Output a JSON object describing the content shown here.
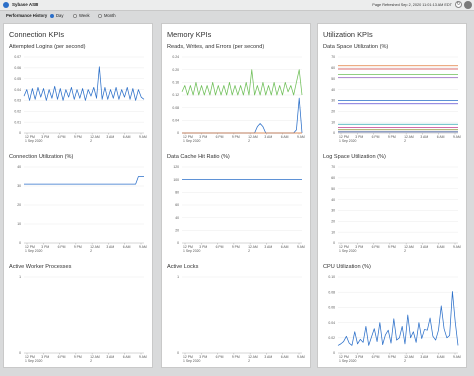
{
  "topbar": {
    "db_name": "Sybase ASE",
    "caret": "▾",
    "refreshed": "Page Refreshed Sep 2, 2020 11:01:13 AM EDT",
    "refresh_icon": "↻"
  },
  "history": {
    "label": "Performance History",
    "options": [
      "Day",
      "Week",
      "Month"
    ],
    "selected": "Day"
  },
  "columns": [
    {
      "title": "Connection KPIs",
      "charts": [
        {
          "title": "Attempted Logins (per second)"
        },
        {
          "title": "Connection Utilization (%)"
        },
        {
          "title": "Active Worker Processes"
        }
      ]
    },
    {
      "title": "Memory KPIs",
      "charts": [
        {
          "title": "Reads, Writes, and Errors (per second)"
        },
        {
          "title": "Data Cache Hit Ratio (%)"
        },
        {
          "title": "Active Locks"
        }
      ]
    },
    {
      "title": "Utilization KPIs",
      "charts": [
        {
          "title": "Data Space Utilization (%)"
        },
        {
          "title": "Log Space Utilization (%)"
        },
        {
          "title": "CPU Utilization (%)"
        }
      ]
    }
  ],
  "x_ticks": [
    "12 PM\n1 Sep 2020",
    "3 PM",
    "6 PM",
    "9 PM",
    "12 AM\n2",
    "3 AM",
    "6 AM",
    "9 AM"
  ],
  "chart_data": [
    {
      "type": "line",
      "title": "Attempted Logins (per second)",
      "ylim": [
        0,
        0.07
      ],
      "yticks": [
        "0",
        "0.01",
        "0.02",
        "0.03",
        "0.04",
        "0.05",
        "0.06",
        "0.07"
      ],
      "series": [
        {
          "color": "#2b6fc9",
          "values": [
            0.034,
            0.04,
            0.03,
            0.041,
            0.031,
            0.042,
            0.033,
            0.041,
            0.03,
            0.04,
            0.032,
            0.043,
            0.031,
            0.041,
            0.03,
            0.04,
            0.033,
            0.042,
            0.031,
            0.04,
            0.032,
            0.041,
            0.03,
            0.04,
            0.034,
            0.042,
            0.032,
            0.061,
            0.031,
            0.042,
            0.031,
            0.04,
            0.032,
            0.042,
            0.031,
            0.04,
            0.033,
            0.042,
            0.031,
            0.041,
            0.03,
            0.04,
            0.033,
            0.031
          ]
        }
      ]
    },
    {
      "type": "line",
      "title": "Connection Utilization (%)",
      "ylim": [
        0,
        40
      ],
      "yticks": [
        "0",
        "10",
        "20",
        "30",
        "40"
      ],
      "series": [
        {
          "color": "#2b6fc9",
          "values": [
            31,
            31,
            31,
            31,
            31,
            31,
            31,
            31,
            31,
            31,
            31,
            31,
            31,
            31,
            31,
            31,
            31,
            31,
            31,
            31,
            31,
            31,
            31,
            31,
            31,
            31,
            31,
            31,
            31,
            31,
            31,
            31,
            31,
            31,
            31,
            31,
            31,
            31,
            31,
            31,
            31,
            35,
            35,
            35
          ]
        }
      ]
    },
    {
      "type": "line",
      "title": "Active Worker Processes",
      "ylim": [
        0,
        1
      ],
      "yticks": [
        "0",
        "1"
      ],
      "series": []
    },
    {
      "type": "line",
      "title": "Reads, Writes, and Errors (per second)",
      "ylim": [
        0,
        0.24
      ],
      "yticks": [
        "0",
        "0.04",
        "0.08",
        "0.12",
        "0.16",
        "0.20",
        "0.24"
      ],
      "series": [
        {
          "color": "#6fbf59",
          "values": [
            0.13,
            0.15,
            0.12,
            0.15,
            0.12,
            0.16,
            0.12,
            0.15,
            0.12,
            0.15,
            0.12,
            0.16,
            0.12,
            0.15,
            0.12,
            0.15,
            0.12,
            0.16,
            0.12,
            0.15,
            0.12,
            0.15,
            0.12,
            0.16,
            0.12,
            0.2,
            0.12,
            0.15,
            0.12,
            0.16,
            0.12,
            0.15,
            0.12,
            0.16,
            0.12,
            0.15,
            0.12,
            0.16,
            0.13,
            0.15,
            0.12,
            0.16,
            0.2,
            0.12
          ]
        },
        {
          "color": "#2b6fc9",
          "values": [
            0,
            0,
            0,
            0,
            0,
            0,
            0,
            0,
            0,
            0,
            0,
            0,
            0,
            0,
            0,
            0,
            0,
            0,
            0,
            0,
            0,
            0,
            0,
            0,
            0,
            0,
            0,
            0.02,
            0.03,
            0.02,
            0,
            0,
            0,
            0,
            0,
            0,
            0,
            0,
            0,
            0,
            0,
            0.01,
            0.11,
            0
          ]
        },
        {
          "color": "#e07b39",
          "values": [
            0,
            0,
            0,
            0,
            0,
            0,
            0,
            0,
            0,
            0,
            0,
            0,
            0,
            0,
            0,
            0,
            0,
            0,
            0,
            0,
            0,
            0,
            0,
            0,
            0,
            0,
            0,
            0,
            0,
            0,
            0,
            0,
            0,
            0,
            0,
            0,
            0,
            0,
            0,
            0,
            0,
            0,
            0,
            0
          ]
        }
      ]
    },
    {
      "type": "line",
      "title": "Data Cache Hit Ratio (%)",
      "ylim": [
        0,
        120
      ],
      "yticks": [
        "0",
        "20",
        "40",
        "60",
        "80",
        "100",
        "120"
      ],
      "series": [
        {
          "color": "#2b6fc9",
          "values": [
            100,
            100
          ]
        }
      ]
    },
    {
      "type": "line",
      "title": "Active Locks",
      "ylim": [
        0,
        1
      ],
      "yticks": [
        "0",
        "1"
      ],
      "series": []
    },
    {
      "type": "line",
      "title": "Data Space Utilization (%)",
      "ylim": [
        0,
        70
      ],
      "yticks": [
        "0",
        "10",
        "20",
        "30",
        "40",
        "50",
        "60",
        "70"
      ],
      "series": [
        {
          "color": "#e07b39",
          "values": [
            62,
            62
          ]
        },
        {
          "color": "#d13c3c",
          "values": [
            59,
            59
          ]
        },
        {
          "color": "#6fbf59",
          "values": [
            54,
            54
          ]
        },
        {
          "color": "#9b6cc4",
          "values": [
            51,
            51
          ]
        },
        {
          "color": "#2b6fc9",
          "values": [
            30,
            30
          ]
        },
        {
          "color": "#5b4ad1",
          "values": [
            27,
            27
          ]
        },
        {
          "color": "#2fa8b0",
          "values": [
            8,
            8
          ]
        },
        {
          "color": "#c43b8f",
          "values": [
            5,
            5
          ]
        },
        {
          "color": "#8a8a2a",
          "values": [
            3,
            3
          ]
        },
        {
          "color": "#1f3e8a",
          "values": [
            1,
            1
          ]
        }
      ]
    },
    {
      "type": "line",
      "title": "Log Space Utilization (%)",
      "ylim": [
        0,
        70
      ],
      "yticks": [
        "0",
        "10",
        "20",
        "30",
        "40",
        "50",
        "60",
        "70"
      ],
      "series": []
    },
    {
      "type": "line",
      "title": "CPU Utilization (%)",
      "ylim": [
        0,
        0.1
      ],
      "yticks": [
        "0",
        "0.02",
        "0.04",
        "0.06",
        "0.08",
        "0.10"
      ],
      "series": [
        {
          "color": "#2b6fc9",
          "values": [
            0.01,
            0.012,
            0.015,
            0.022,
            0.013,
            0.01,
            0.028,
            0.012,
            0.018,
            0.014,
            0.035,
            0.01,
            0.021,
            0.032,
            0.015,
            0.04,
            0.011,
            0.024,
            0.03,
            0.013,
            0.045,
            0.017,
            0.02,
            0.035,
            0.012,
            0.05,
            0.02,
            0.028,
            0.014,
            0.04,
            0.019,
            0.031,
            0.03,
            0.046,
            0.022,
            0.017,
            0.03,
            0.062,
            0.032,
            0.02,
            0.023,
            0.081,
            0.041,
            0.01
          ]
        }
      ]
    }
  ]
}
